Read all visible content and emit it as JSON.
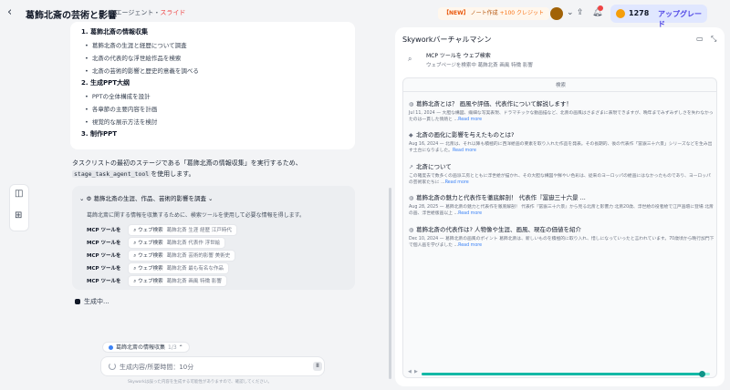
{
  "header": {
    "back_glyph": "‹",
    "title": "葛飾北斎の芸術と影響",
    "mode_agent": "エージェント",
    "mode_sep": "・",
    "mode_slide": "スライド",
    "promo_new": "【NEW】",
    "promo_text": "ノート作成",
    "promo_credit": "+100 クレジット",
    "credits_value": "1278",
    "upgrade_label": "アップグレード"
  },
  "plan": {
    "sections": [
      {
        "heading": "1. 葛飾北斎の情報収集",
        "items": [
          "葛飾北斎の生涯と経歴について調査",
          "北斎の代表的な浮世絵作品を検索",
          "北斎の芸術的影響と歴史的意義を調べる"
        ]
      },
      {
        "heading": "2. 生成PPT大纲",
        "items": [
          "PPTの全体構成を設計",
          "各章節の主要内容を計画",
          "視覚的な展示方法を検討"
        ]
      },
      {
        "heading": "3. 制作PPT",
        "items": []
      }
    ]
  },
  "intro": {
    "line1": "タスクリストの最初のステージである「葛飾北斎の情報収集」を実行するため、",
    "code": "stage_task_agent_tool",
    "line2_suffix": "を使用します。"
  },
  "task": {
    "title": "葛飾北斎の生涯、作品、芸術的影響を調査",
    "desc": "葛飾北斎に関する情報を収集するために、検索ツールを使用して必要な情報を得します。",
    "tool_label": "MCP ツールを",
    "search_label": "ウェブ検索",
    "queries": [
      "葛飾北斎 生涯 経歴 江戸時代",
      "葛飾北斎 代表作 浮世絵",
      "葛飾北斎 芸術的影響 美術史",
      "葛飾北斎 最も有名な作品",
      "葛飾北斎 画風 特徴 影響"
    ]
  },
  "generating": "生成中...",
  "status_pill": {
    "label": "葛飾北斎の情報収集",
    "count": "1/3"
  },
  "input": {
    "placeholder": "生成内容/所要時間：10分",
    "pause": "II"
  },
  "disclaimer": "Skyworkは誤った内容を生成する可能性がありますので、確認してください。",
  "vm": {
    "title": "Skyworkバーチャルマシン",
    "tool_line1": "MCP ツールを ウェブ検索",
    "tool_line2": "ウェブページを検索中 葛飾北斎 画風 特徴 影響",
    "browser_title": "検索",
    "results": [
      {
        "title": "葛飾北斎とは？ 画風や評価、代表作について解説します！",
        "snippet": "Jul 11, 2024 — 大胆な構図、繊細な写実表現、ドラマチックな動画描など、北斎の画風はさまざまに表現できますが、晩年までみずみずしさを失わなかったのは一貫した情熱と ...",
        "more": "Read more"
      },
      {
        "title": "北斎の画化に影響を与えたものとは?",
        "snippet": "Aug 16, 2024 — 北斎は、それ以降も積極的に西洋絵画の要素を取り入れた作品を発表。その長期的、後の代表作「冨嶽三十六景」シリーズなどを生み出す土台になりました。",
        "more": "Read more"
      },
      {
        "title": "北斎について",
        "snippet": "この確度去で数多くの画派工房とともに浮世絵が描かれ、その大胆な構図や鮮やい色彩は、従来のヨーロッパの絵画にはなかったものであり、ヨーロッパの芸術家たちに ...",
        "more": "Read more"
      },
      {
        "title": "葛飾北斎の魅力と代表作を徹底解剖！ 代表作『冨嶽三十六景 ...",
        "snippet": "Aug 28, 2025 — 葛飾北斎の魅力と代表作を徹底解剖！ 代表作『冨嶽三十六景』から見る北斎と影響力 北斎20歳、浮世絵の役者絵で江戸画壇に登場 北斎の画、浮世絵版画以上 ...",
        "more": "Read more"
      },
      {
        "title": "葛飾北斎の代表作は? 人物像や生涯、画風、現在の価値を紹介",
        "snippet": "Dec 10, 2024 — 葛飾北斎の画風のポイント 葛飾北斎は、新しいものを積極的に取り入れ、惜しになっていったと言われています。70歳頃から晩行加門下で個人画を学びました ...",
        "more": "Read more"
      }
    ],
    "progress": 0.97
  },
  "colors": {
    "accent": "#14b8a6",
    "link": "#3b82f6",
    "brand": "#4f46e5"
  }
}
